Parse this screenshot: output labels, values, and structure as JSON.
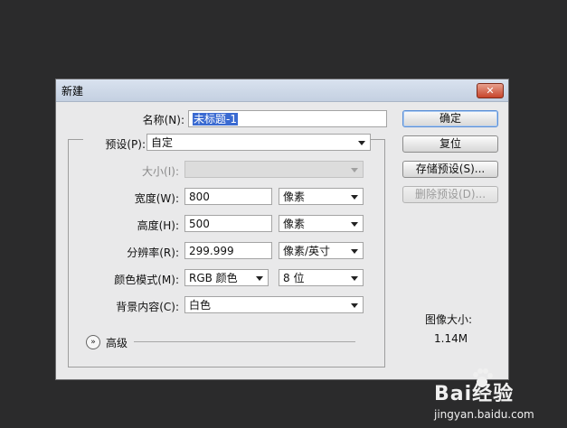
{
  "dialog": {
    "title": "新建",
    "close_icon": "close-icon"
  },
  "form": {
    "name_label": "名称(N):",
    "name_value": "未标题-1",
    "preset_label": "预设(P):",
    "preset_value": "自定",
    "size_label": "大小(I):",
    "size_value": "",
    "width_label": "宽度(W):",
    "width_value": "800",
    "width_unit": "像素",
    "height_label": "高度(H):",
    "height_value": "500",
    "height_unit": "像素",
    "resolution_label": "分辨率(R):",
    "resolution_value": "299.999",
    "resolution_unit": "像素/英寸",
    "color_mode_label": "颜色模式(M):",
    "color_mode_value": "RGB 颜色",
    "bit_depth_value": "8 位",
    "background_label": "背景内容(C):",
    "background_value": "白色",
    "advanced_label": "高级"
  },
  "buttons": {
    "ok": "确定",
    "reset": "复位",
    "save_preset": "存储预设(S)...",
    "delete_preset": "删除预设(D)..."
  },
  "info": {
    "image_size_label": "图像大小:",
    "image_size_value": "1.14M"
  },
  "watermark": {
    "logo": "Bai经验",
    "site": "jingyan.baidu.com"
  }
}
